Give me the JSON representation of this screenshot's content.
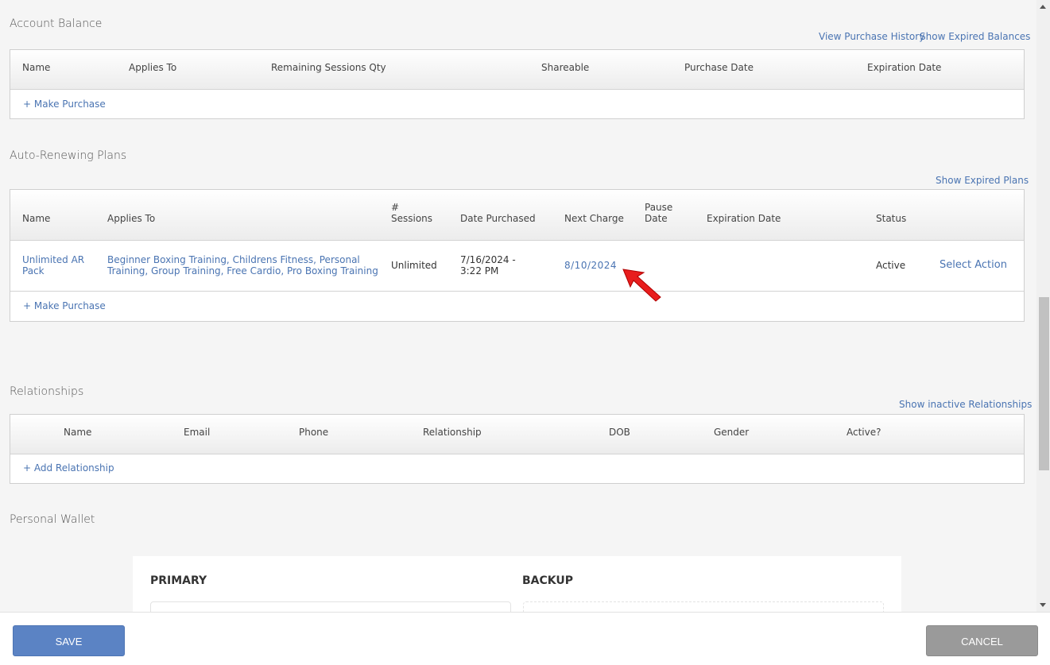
{
  "account_balance": {
    "title": "Account Balance",
    "links": [
      "View Purchase History",
      "Show Expired Balances"
    ],
    "headers": [
      "Name",
      "Applies To",
      "Remaining Sessions Qty",
      "Shareable",
      "Purchase Date",
      "Expiration Date"
    ],
    "make_purchase": "+ Make Purchase"
  },
  "auto_renewing": {
    "title": "Auto-Renewing Plans",
    "link": "Show Expired Plans",
    "headers": [
      "Name",
      "Applies To",
      "#\nSessions",
      "Date Purchased",
      "Next Charge",
      "Pause\nDate",
      "Expiration Date",
      "Status"
    ],
    "row": {
      "name": "Unlimited AR\nPack",
      "applies_to": "Beginner Boxing Training, Childrens Fitness, Personal\nTraining, Group Training, Free Cardio, Pro Boxing Training",
      "sessions": "Unlimited",
      "date_purchased": "7/16/2024 -\n3:22 PM",
      "next_charge": "8/10/2024",
      "status": "Active",
      "action": "Select Action"
    },
    "make_purchase": "+ Make Purchase"
  },
  "relationships": {
    "title": "Relationships",
    "link": "Show inactive Relationships",
    "headers": [
      "Name",
      "Email",
      "Phone",
      "Relationship",
      "DOB",
      "Gender",
      "Active?"
    ],
    "add": "+ Add Relationship"
  },
  "wallet": {
    "title": "Personal Wallet",
    "primary": "PRIMARY",
    "backup": "BACKUP"
  },
  "footer": {
    "save": "SAVE",
    "cancel": "CANCEL"
  },
  "colors": {
    "link": "#4a74b2",
    "save": "#5b83c4",
    "cancel": "#9a9a9a",
    "arrow": "#e81d1d"
  }
}
